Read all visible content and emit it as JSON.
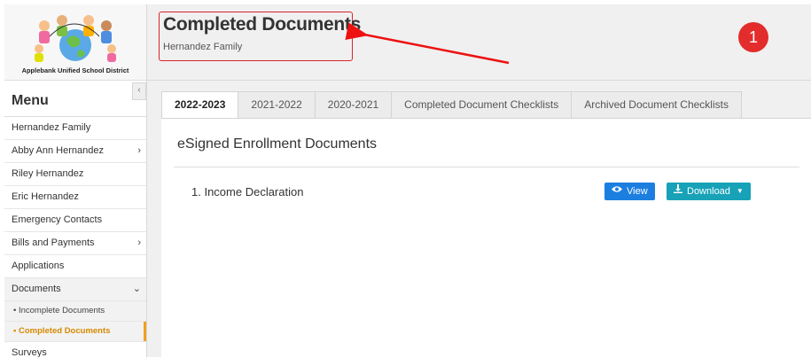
{
  "sidebar": {
    "school_name": "Applebank Unified School District",
    "menu_title": "Menu",
    "collapse_glyph": "‹",
    "items": [
      {
        "label": "Hernandez Family"
      },
      {
        "label": "Abby Ann Hernandez",
        "chevron": "›"
      },
      {
        "label": "Riley Hernandez"
      },
      {
        "label": "Eric Hernandez"
      },
      {
        "label": "Emergency Contacts"
      },
      {
        "label": "Bills and Payments",
        "chevron": "›"
      },
      {
        "label": "Applications"
      },
      {
        "label": "Documents",
        "chevron": "⌄"
      }
    ],
    "sub_items": [
      {
        "label": "• Incomplete Documents"
      },
      {
        "label": "• Completed Documents"
      }
    ],
    "after_items": [
      {
        "label": "Surveys"
      }
    ]
  },
  "header": {
    "title": "Completed Documents",
    "subtitle": "Hernandez Family",
    "badge_number": "1",
    "highlight_color": "#d6252b"
  },
  "tabs": [
    {
      "label": "2022-2023",
      "active": true
    },
    {
      "label": "2021-2022"
    },
    {
      "label": "2020-2021"
    },
    {
      "label": "Completed Document Checklists"
    },
    {
      "label": "Archived Document Checklists"
    }
  ],
  "content": {
    "section_title": "eSigned Enrollment Documents",
    "documents": [
      {
        "label": "1. Income Declaration",
        "view_label": "View",
        "download_label": "Download"
      }
    ]
  },
  "icons": {
    "view": "eye-icon",
    "download": "download-icon",
    "dropdown": "caret-down-icon"
  }
}
